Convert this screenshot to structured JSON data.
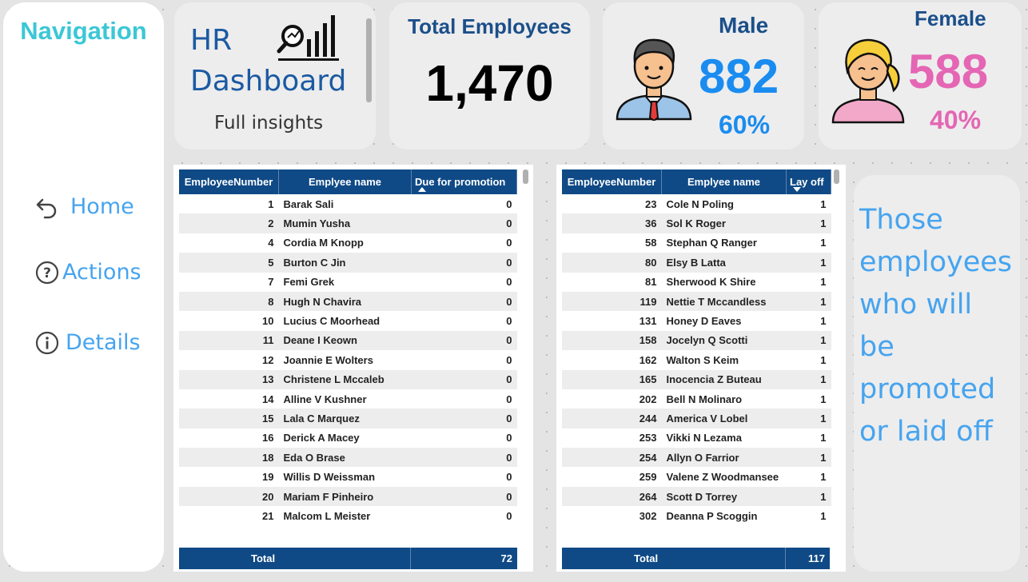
{
  "navigation": {
    "title": "Navigation",
    "items": [
      {
        "label": "Home",
        "icon": "undo-arrow-icon"
      },
      {
        "label": "Actions",
        "icon": "question-circle-icon"
      },
      {
        "label": "Details",
        "icon": "info-circle-icon"
      }
    ]
  },
  "header": {
    "title_line1": "HR",
    "title_line2": "Dashboard",
    "subtitle": "Full insights",
    "icon": "chart-magnifier-icon"
  },
  "kpis": {
    "total": {
      "title": "Total Employees",
      "value": "1,470"
    },
    "male": {
      "title": "Male",
      "value": "882",
      "percent": "60%",
      "color": "#1a8cf0"
    },
    "female": {
      "title": "Female",
      "value": "588",
      "percent": "40%",
      "color": "#e466b4"
    }
  },
  "promotion_table": {
    "headers": [
      "EmployeeNumber",
      "Emplyee name",
      "Due for promotion"
    ],
    "rows": [
      [
        "1",
        "Barak Sali",
        "0"
      ],
      [
        "2",
        "Mumin Yusha",
        "0"
      ],
      [
        "4",
        "Cordia M Knopp",
        "0"
      ],
      [
        "5",
        "Burton C Jin",
        "0"
      ],
      [
        "7",
        "Femi Grek",
        "0"
      ],
      [
        "8",
        "Hugh N Chavira",
        "0"
      ],
      [
        "10",
        "Lucius C Moorhead",
        "0"
      ],
      [
        "11",
        "Deane I Keown",
        "0"
      ],
      [
        "12",
        "Joannie E Wolters",
        "0"
      ],
      [
        "13",
        "Christene L Mccaleb",
        "0"
      ],
      [
        "14",
        "Alline V Kushner",
        "0"
      ],
      [
        "15",
        "Lala C Marquez",
        "0"
      ],
      [
        "16",
        "Derick A Macey",
        "0"
      ],
      [
        "18",
        "Eda O Brase",
        "0"
      ],
      [
        "19",
        "Willis D Weissman",
        "0"
      ],
      [
        "20",
        "Mariam F Pinheiro",
        "0"
      ],
      [
        "21",
        "Malcom L Meister",
        "0"
      ]
    ],
    "total_label": "Total",
    "total_value": "72"
  },
  "layoff_table": {
    "headers": [
      "EmployeeNumber",
      "Emplyee name",
      "Lay off"
    ],
    "rows": [
      [
        "23",
        "Cole N Poling",
        "1"
      ],
      [
        "36",
        "Sol K Roger",
        "1"
      ],
      [
        "58",
        "Stephan Q Ranger",
        "1"
      ],
      [
        "80",
        "Elsy B Latta",
        "1"
      ],
      [
        "81",
        "Sherwood K Shire",
        "1"
      ],
      [
        "119",
        "Nettie T Mccandless",
        "1"
      ],
      [
        "131",
        "Honey D Eaves",
        "1"
      ],
      [
        "158",
        "Jocelyn Q Scotti",
        "1"
      ],
      [
        "162",
        "Walton S Keim",
        "1"
      ],
      [
        "165",
        "Inocencia Z Buteau",
        "1"
      ],
      [
        "202",
        "Bell N Molinaro",
        "1"
      ],
      [
        "244",
        "America V Lobel",
        "1"
      ],
      [
        "253",
        "Vikki N Lezama",
        "1"
      ],
      [
        "254",
        "Allyn O Farrior",
        "1"
      ],
      [
        "259",
        "Valene Z Woodmansee",
        "1"
      ],
      [
        "264",
        "Scott D Torrey",
        "1"
      ],
      [
        "302",
        "Deanna P Scoggin",
        "1"
      ]
    ],
    "total_label": "Total",
    "total_value": "117"
  },
  "note": {
    "text": "Those employees who will be promoted or laid off"
  }
}
